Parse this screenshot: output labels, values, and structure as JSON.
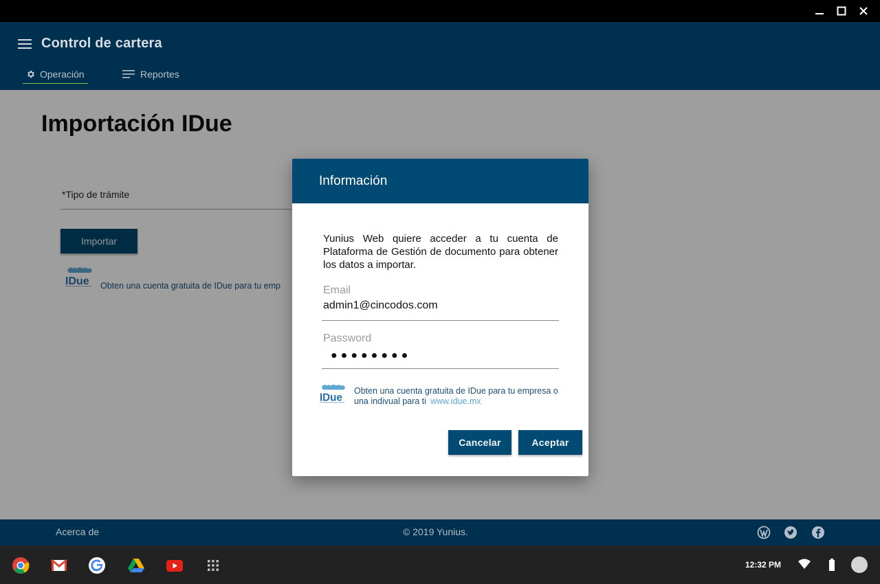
{
  "window": {
    "controls": [
      "minimize",
      "maximize",
      "close"
    ]
  },
  "app": {
    "title": "Control de cartera",
    "nav": [
      {
        "label": "Operación",
        "icon": "gear-icon",
        "active": true
      },
      {
        "label": "Reportes",
        "icon": "list-icon",
        "active": false
      }
    ]
  },
  "page": {
    "title": "Importación IDue",
    "field_label": "*Tipo de trámite",
    "import_button": "Importar",
    "promo_text": "Obten una cuenta gratuita de IDue para tu emp"
  },
  "logo": {
    "text": "IDue"
  },
  "dialog": {
    "title": "Información",
    "message": "Yunius Web quiere acceder a tu cuenta de Plataforma de Gestión de documento para obtener los datos a importar.",
    "email_label": "Email",
    "email_value": "admin1@cincodos.com",
    "password_label": "Password",
    "password_value": "●●●●●●●●",
    "promo_text": "Obten una cuenta gratuita de IDue para tu empresa o una indivual para ti",
    "promo_link": "www.idue.mx",
    "cancel_button": "Cancelar",
    "accept_button": "Aceptar"
  },
  "footer": {
    "about": "Acerca de",
    "copyright": "© 2019 Yunius.",
    "social_icons": [
      "wordpress-icon",
      "twitter-icon",
      "facebook-icon"
    ]
  },
  "taskbar": {
    "apps": [
      "chrome-icon",
      "gmail-icon",
      "google-icon",
      "drive-icon",
      "youtube-icon",
      "launcher-icon"
    ],
    "time": "12:32 PM"
  },
  "colors": {
    "header": "#00304f",
    "primary_button": "#004a73",
    "dialog_header": "#004a73",
    "active_tab_underline": "#8bc34a",
    "link": "#5fa8d3"
  }
}
